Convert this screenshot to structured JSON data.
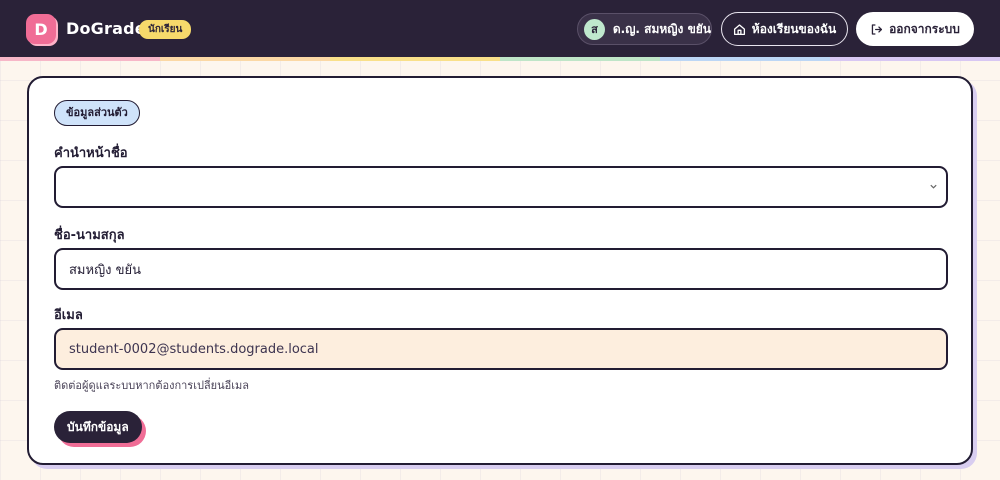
{
  "app": {
    "logo_letter": "D",
    "brand": "DoGrade",
    "role_badge": "นักเรียน"
  },
  "header": {
    "user_initial": "ส",
    "user_name": "ด.ญ. สมหญิง ขยัน",
    "classroom_label": "ห้องเรียนของฉัน",
    "logout_label": "ออกจากระบบ"
  },
  "form": {
    "section_title": "ข้อมูลส่วนตัว",
    "prefix": {
      "label": "คำนำหน้าชื่อ",
      "value": ""
    },
    "fullname": {
      "label": "ชื่อ-นามสกุล",
      "value": "สมหญิง ขยัน"
    },
    "email": {
      "label": "อีเมล",
      "value": "student-0002@students.dograde.local",
      "hint": "ติดต่อผู้ดูแลระบบหากต้องการเปลี่ยนอีเมล"
    },
    "save_label": "บันทึกข้อมูล"
  },
  "colors": {
    "topbar": "#2a2238",
    "accent_pink": "#f06d96",
    "badge_yellow": "#f6d96b",
    "chip_blue": "#cfe3fa",
    "readonly_field": "#fdeede"
  },
  "icons": {
    "home": "home-icon",
    "logout": "logout-icon",
    "select": "chevron-down-icon"
  }
}
